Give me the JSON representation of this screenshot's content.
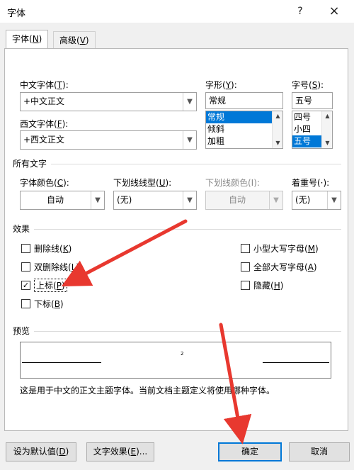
{
  "dialog": {
    "title": "字体",
    "help_icon": "?",
    "close_icon": "×"
  },
  "tabs": [
    {
      "label": "字体(",
      "key": "N",
      "end": ")"
    },
    {
      "label": "高级(",
      "key": "V",
      "end": ")"
    }
  ],
  "font": {
    "chinese_label": "中文字体(",
    "chinese_key": "T",
    "chinese_end": "):",
    "chinese_value": "+中文正文",
    "western_label": "西文字体(",
    "western_key": "F",
    "western_end": "):",
    "western_value": "+西文正文",
    "style_label": "字形(",
    "style_key": "Y",
    "style_end": "):",
    "style_value": "常规",
    "style_options": [
      "常规",
      "倾斜",
      "加粗"
    ],
    "size_label": "字号(",
    "size_key": "S",
    "size_end": "):",
    "size_value": "五号",
    "size_options": [
      "四号",
      "小四",
      "五号"
    ]
  },
  "all_text": {
    "section_title": "所有文字",
    "color_label": "字体颜色(",
    "color_key": "C",
    "color_end": "):",
    "color_value": "自动",
    "underline_label": "下划线线型(",
    "underline_key": "U",
    "underline_end": "):",
    "underline_value": "(无)",
    "underline_color_label": "下划线颜色(I):",
    "underline_color_value": "自动",
    "emphasis_label": "着重号(·):",
    "emphasis_value": "(无)"
  },
  "effects": {
    "section_title": "效果",
    "strikethrough": {
      "label": "删除线(",
      "key": "K",
      "end": ")",
      "checked": false
    },
    "double_strikethrough": {
      "label": "双删除线(",
      "key": "L",
      "end": ")",
      "checked": false
    },
    "superscript": {
      "label": "上标(",
      "key": "P",
      "end": ")",
      "checked": true
    },
    "subscript": {
      "label": "下标(",
      "key": "B",
      "end": ")",
      "checked": false
    },
    "small_caps": {
      "label": "小型大写字母(",
      "key": "M",
      "end": ")",
      "checked": false
    },
    "all_caps": {
      "label": "全部大写字母(",
      "key": "A",
      "end": ")",
      "checked": false
    },
    "hidden": {
      "label": "隐藏(",
      "key": "H",
      "end": ")",
      "checked": false
    },
    "check_glyph": "✓"
  },
  "preview": {
    "section_title": "预览",
    "sample": "2",
    "description": "这是用于中文的正文主题字体。当前文档主题定义将使用哪种字体。"
  },
  "buttons": {
    "set_default": {
      "label": "设为默认值(",
      "key": "D",
      "end": ")"
    },
    "text_effects": {
      "label": "文字效果(",
      "key": "E",
      "end": ")..."
    },
    "ok": "确定",
    "cancel": "取消"
  },
  "colors": {
    "accent": "#0078d7",
    "annotation_red": "#e8382f"
  }
}
